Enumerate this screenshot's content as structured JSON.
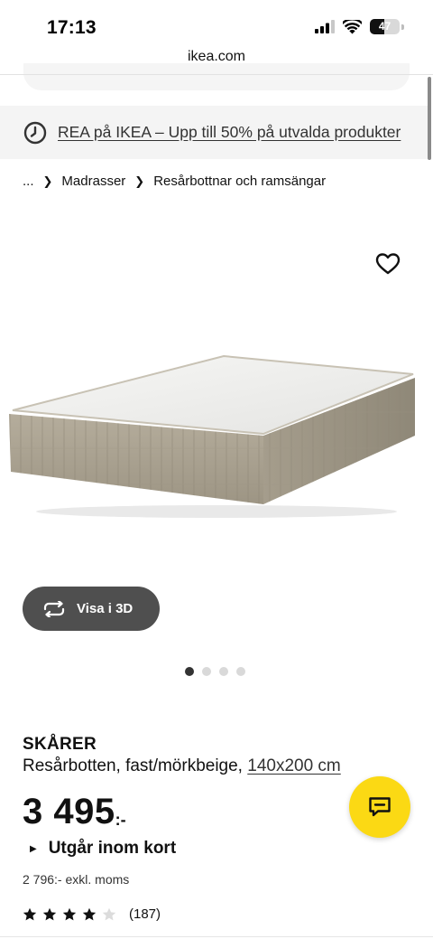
{
  "status_bar": {
    "time": "17:13",
    "battery_percent": "47",
    "battery_level": 0.47,
    "icons": [
      "signal-icon",
      "wifi-icon",
      "battery-icon"
    ]
  },
  "browser": {
    "url": "ikea.com"
  },
  "promo_banner": {
    "icon": "clock-icon",
    "text": "REA på IKEA – Upp till 50% på utvalda produkter"
  },
  "breadcrumb": {
    "items": [
      "...",
      "Madrasser",
      "Resårbottnar och ramsängar"
    ]
  },
  "gallery": {
    "favorite_icon": "heart-outline-icon",
    "view_3d_label": "Visa i 3D",
    "view_3d_icon": "rotate-arrows-icon",
    "image_count": 4,
    "active_index": 0
  },
  "product": {
    "name": "SKÅRER",
    "description": "Resårbotten, fast/mörkbeige,",
    "size": "140x200 cm",
    "price": "3 495",
    "price_suffix": ":-",
    "availability": "Utgår inom kort",
    "price_excl_vat": "2 796:- exkl. moms",
    "rating": 4,
    "rating_max": 5,
    "review_count": "(187)"
  },
  "chat": {
    "icon": "chat-bubble-icon"
  },
  "colors": {
    "accent_yellow": "#fbd914",
    "button_dark": "#4f4f4f",
    "banner_bg": "#f4f4f4",
    "fabric_beige": "#a89f8e"
  }
}
